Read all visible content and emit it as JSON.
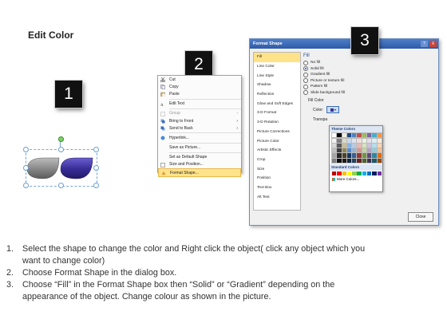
{
  "title": "Edit Color",
  "steps": [
    "1",
    "2",
    "3"
  ],
  "context_menu": {
    "items": [
      {
        "label": "Cut",
        "disabled": false
      },
      {
        "label": "Copy",
        "disabled": false
      },
      {
        "label": "Paste",
        "disabled": false
      },
      {
        "label": "Edit Text",
        "disabled": false
      },
      {
        "label": "Group",
        "disabled": true,
        "arrow": "›"
      },
      {
        "label": "Bring to Front",
        "disabled": false,
        "arrow": "›"
      },
      {
        "label": "Send to Back",
        "disabled": false,
        "arrow": "›"
      },
      {
        "label": "Hyperlink...",
        "disabled": false
      },
      {
        "label": "Save as Picture...",
        "disabled": false
      },
      {
        "label": "Set as Default Shape",
        "disabled": false
      },
      {
        "label": "Size and Position...",
        "disabled": false
      },
      {
        "label": "Format Shape...",
        "disabled": false,
        "highlighted": true
      }
    ]
  },
  "dialog": {
    "title": "Format Shape",
    "help": "?",
    "close": "X",
    "nav": [
      "Fill",
      "Line Color",
      "Line Style",
      "Shadow",
      "Reflection",
      "Glow and Soft Edges",
      "3-D Format",
      "3-D Rotation",
      "Picture Corrections",
      "Picture Color",
      "Artistic Effects",
      "Crop",
      "Size",
      "Position",
      "Text Box",
      "Alt Text"
    ],
    "section_title": "Fill",
    "fill_options": [
      {
        "label": "No fill",
        "selected": false
      },
      {
        "label": "Solid fill",
        "selected": true
      },
      {
        "label": "Gradient fill",
        "selected": false
      },
      {
        "label": "Picture or texture fill",
        "selected": false
      },
      {
        "label": "Pattern fill",
        "selected": false
      },
      {
        "label": "Slide background fill",
        "selected": false
      }
    ],
    "fill_color_label": "Fill Color",
    "color_label": "Color:",
    "transparency_label": "Transpa",
    "close_button": "Close"
  },
  "palette": {
    "theme_header": "Theme Colors",
    "standard_header": "Standard Colors",
    "more_colors": "More Colors...",
    "theme_colors": [
      [
        "#ffffff",
        "#000000",
        "#eeece1",
        "#1f497d",
        "#4f81bd",
        "#c0504d",
        "#9bbb59",
        "#8064a2",
        "#4bacc6",
        "#f79646"
      ],
      [
        "#f2f2f2",
        "#7f7f7f",
        "#ddd9c3",
        "#c6d9f0",
        "#dbe5f1",
        "#f2dcdb",
        "#ebf1dd",
        "#e5e0ec",
        "#dbeef3",
        "#fdeada"
      ],
      [
        "#d8d8d8",
        "#595959",
        "#c4bd97",
        "#8db3e2",
        "#b8cce4",
        "#e5b9b7",
        "#d7e3bc",
        "#ccc1d9",
        "#b7dde8",
        "#fbd5b5"
      ],
      [
        "#bfbfbf",
        "#3f3f3f",
        "#938953",
        "#548dd4",
        "#95b3d7",
        "#d99694",
        "#c3d69b",
        "#b2a2c7",
        "#92cddc",
        "#fac08f"
      ],
      [
        "#a5a5a5",
        "#262626",
        "#494429",
        "#17365d",
        "#366092",
        "#953734",
        "#76923c",
        "#5f497a",
        "#31859b",
        "#e36c09"
      ],
      [
        "#7f7f7f",
        "#0c0c0c",
        "#1d1b10",
        "#0f243e",
        "#244061",
        "#632423",
        "#4f6128",
        "#3f3151",
        "#205867",
        "#974806"
      ]
    ],
    "standard_colors": [
      "#c00000",
      "#ff0000",
      "#ffc000",
      "#ffff00",
      "#92d050",
      "#00b050",
      "#00b0f0",
      "#0070c0",
      "#002060",
      "#7030a0"
    ]
  },
  "instructions": [
    {
      "num": "1.",
      "text": "Select the shape to change the color and Right click the object( click any object which you"
    },
    {
      "num": "",
      "text": "want to change color)"
    },
    {
      "num": "2.",
      "text": "Choose Format Shape in the dialog box."
    },
    {
      "num": "3.",
      "text": "Choose “Fill” in the Format Shape box then “Solid” or “Gradient” depending on the"
    },
    {
      "num": "",
      "text": "appearance of the object. Change colour as shown in the picture."
    }
  ]
}
